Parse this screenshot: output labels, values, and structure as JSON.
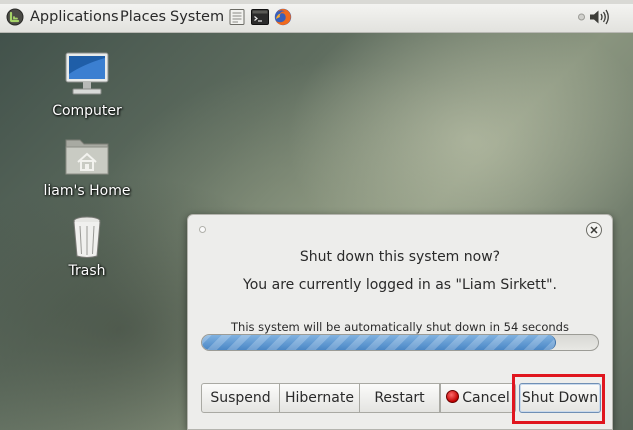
{
  "panel": {
    "menus": [
      "Applications",
      "Places",
      "System"
    ],
    "launchers": [
      "text-editor-icon",
      "terminal-icon",
      "firefox-icon"
    ],
    "tray": [
      "speaker-icon"
    ]
  },
  "desktop": {
    "icons": [
      {
        "label": "Computer",
        "icon": "monitor-icon"
      },
      {
        "label": "liam's Home",
        "icon": "home-folder-icon"
      },
      {
        "label": "Trash",
        "icon": "trash-icon"
      }
    ]
  },
  "dialog": {
    "title": "Shut down this system now?",
    "subtitle": "You are currently logged in as \"Liam Sirkett\".",
    "countdown": "This system will be automatically shut down in 54 seconds",
    "progress": 0.895,
    "buttons": {
      "suspend": "Suspend",
      "hibernate": "Hibernate",
      "restart": "Restart",
      "cancel": "Cancel",
      "shutdown": "Shut Down"
    },
    "highlighted": "shutdown"
  },
  "colors": {
    "progress_fill": "#4a87c6",
    "highlight": "#e0161e",
    "cancel_icon": "#c00000"
  }
}
